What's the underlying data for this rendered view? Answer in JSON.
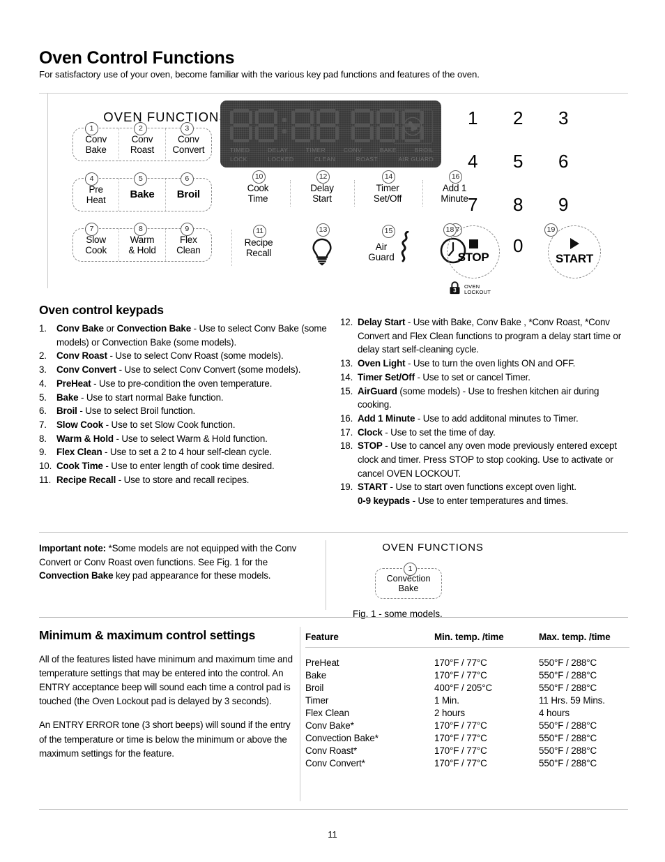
{
  "page": {
    "title": "Oven Control Functions",
    "intro": "For satisfactory use of your oven, become familiar with the various key pad functions and features of the oven.",
    "number": "11"
  },
  "panel": {
    "oven_functions_title": "OVEN FUNCTIONS",
    "groups": [
      {
        "pads": [
          {
            "num": "1",
            "line1": "Conv",
            "line2": "Bake",
            "bold": false
          },
          {
            "num": "2",
            "line1": "Conv",
            "line2": "Roast",
            "bold": false
          },
          {
            "num": "3",
            "line1": "Conv",
            "line2": "Convert",
            "bold": false
          }
        ]
      },
      {
        "pads": [
          {
            "num": "4",
            "line1": "Pre",
            "line2": "Heat",
            "bold": false
          },
          {
            "num": "5",
            "line1": "Bake",
            "line2": "",
            "bold": true
          },
          {
            "num": "6",
            "line1": "Broil",
            "line2": "",
            "bold": true
          }
        ]
      },
      {
        "pads": [
          {
            "num": "7",
            "line1": "Slow",
            "line2": "Cook",
            "bold": false
          },
          {
            "num": "8",
            "line1": "Warm",
            "line2": "& Hold",
            "bold": false
          },
          {
            "num": "9",
            "line1": "Flex",
            "line2": "Clean",
            "bold": false
          }
        ]
      }
    ],
    "display": {
      "digits": "88:88 888",
      "indicator_row_1": [
        "TIMED",
        "DELAY",
        "TIMER",
        "CONV",
        "BAKE",
        "BROIL"
      ],
      "indicator_row_2": [
        "LOCK",
        "LOCKED",
        "CLEAN",
        "ROAST",
        "AIR GUARD"
      ],
      "fan_icon": "convection-fan-icon"
    },
    "mid_pads": [
      {
        "num": "10",
        "line1": "Cook",
        "line2": "Time",
        "icon": ""
      },
      {
        "num": "12",
        "line1": "Delay",
        "line2": "Start",
        "icon": ""
      },
      {
        "num": "14",
        "line1": "Timer",
        "line2": "Set/Off",
        "icon": ""
      },
      {
        "num": "16",
        "line1": "Add 1",
        "line2": "Minute",
        "icon": ""
      },
      {
        "num": "11",
        "line1": "Recipe",
        "line2": "Recall",
        "icon": ""
      },
      {
        "num": "13",
        "line1": "",
        "line2": "",
        "icon": "light-bulb-icon"
      },
      {
        "num": "15",
        "line1": "Air",
        "line2": "Guard",
        "icon": "air-wave-icon"
      },
      {
        "num": "17",
        "line1": "",
        "line2": "",
        "icon": "clock-icon"
      }
    ],
    "numpad": {
      "digits": [
        "1",
        "2",
        "3",
        "4",
        "5",
        "6",
        "7",
        "8",
        "9",
        "0"
      ],
      "stop": {
        "num": "18",
        "label": "STOP",
        "icon": "stop-square-icon"
      },
      "start": {
        "num": "19",
        "label": "START",
        "icon": "play-triangle-icon"
      },
      "lockout": {
        "icon": "padlock-icon",
        "badge": "3",
        "line1": "OVEN",
        "line2": "LOCKOUT"
      }
    }
  },
  "keypads_section": {
    "heading": "Oven control keypads",
    "left_items": [
      {
        "n": "1.",
        "bold": "Conv Bake",
        "bold2": "Convection Bake",
        "text": " or ",
        "rest": " - Use to select Conv Bake (some models) or Convection Bake (some models)."
      },
      {
        "n": "2.",
        "bold": "Conv Roast",
        "rest": " - Use to select Conv Roast (some models)."
      },
      {
        "n": "3.",
        "bold": "Conv Convert",
        "rest": " - Use to select Conv Convert (some models)."
      },
      {
        "n": "4.",
        "bold": "PreHeat",
        "rest": " - Use to pre-condition the oven temperature."
      },
      {
        "n": "5.",
        "bold": "Bake",
        "rest": " - Use to start normal Bake function."
      },
      {
        "n": "6.",
        "bold": "Broil",
        "rest": " - Use to select Broil function."
      },
      {
        "n": "7.",
        "bold": "Slow Cook",
        "rest": " - Use to set Slow Cook function."
      },
      {
        "n": "8.",
        "bold": "Warm & Hold",
        "rest": " - Use to select Warm & Hold function."
      },
      {
        "n": "9.",
        "bold": "Flex Clean",
        "rest": " - Use to set a 2 to 4 hour self-clean cycle."
      },
      {
        "n": "10.",
        "bold": "Cook Time",
        "rest": " - Use to enter length of cook time desired."
      },
      {
        "n": "11.",
        "bold": "Recipe Recall",
        "rest": " - Use to store and recall recipes."
      }
    ],
    "right_items": [
      {
        "n": "12.",
        "bold": "Delay Start",
        "rest": " - Use with Bake, Conv Bake , *Conv Roast, *Conv Convert and Flex Clean functions to program a delay start time or delay start self-cleaning cycle."
      },
      {
        "n": "13.",
        "bold": "Oven Light",
        "rest": " - Use to turn the oven lights ON and OFF."
      },
      {
        "n": "14.",
        "bold": "Timer Set/Off",
        "rest": " - Use to set or cancel Timer."
      },
      {
        "n": "15.",
        "bold": "AirGuard",
        "rest": " (some models) - Use to freshen kitchen air during cooking."
      },
      {
        "n": "16.",
        "bold": "Add 1 Minute",
        "rest": " - Use to add additonal minutes to Timer."
      },
      {
        "n": "17.",
        "bold": "Clock",
        "rest": " - Use to set the time of day."
      },
      {
        "n": "18.",
        "bold": "STOP",
        "rest": " - Use to cancel any oven mode previously entered except clock and timer. Press STOP to stop cooking. Use to activate or cancel OVEN LOCKOUT."
      },
      {
        "n": "19.",
        "bold": "START",
        "rest": " - Use to start oven functions except oven light."
      },
      {
        "n": "",
        "bold": "0-9 keypads",
        "rest": " - Use to enter temperatures and times."
      }
    ]
  },
  "note": {
    "label": "Important note:",
    "text_1": " *Some models are not equipped with the Conv Convert or Conv Roast oven functions. See Fig. 1 for the ",
    "bold_2": "Convection Bake",
    "text_2": " key pad appearance for these models."
  },
  "fig1": {
    "title": "OVEN FUNCTIONS",
    "pad_num": "1",
    "pad_line1": "Convection",
    "pad_line2": "Bake",
    "caption": "Fig. 1 - some models."
  },
  "minmax": {
    "heading": "Minimum & maximum control settings",
    "para1": "All of the features listed have minimum and maximum time and temperature settings that may be entered into the control.  An ENTRY acceptance beep will sound each time a control pad is touched (the Oven Lockout pad is delayed by 3 seconds).",
    "para2": "An ENTRY ERROR tone (3 short beeps) will sound if the entry of the temperature or time is below the minimum or above the maximum settings for the feature."
  },
  "table": {
    "headers": [
      "Feature",
      "Min. temp. /time",
      "Max. temp. /time"
    ],
    "rows": [
      [
        "PreHeat",
        "170°F / 77°C",
        "550°F / 288°C"
      ],
      [
        "Bake",
        "170°F / 77°C",
        "550°F / 288°C"
      ],
      [
        "Broil",
        "400°F / 205°C",
        "550°F / 288°C"
      ],
      [
        "Timer",
        "1 Min.",
        "11 Hrs. 59 Mins."
      ],
      [
        "Flex Clean",
        "2 hours",
        "4 hours"
      ],
      [
        "Conv Bake*",
        "170°F / 77°C",
        "550°F / 288°C"
      ],
      [
        "Convection Bake*",
        "170°F / 77°C",
        "550°F / 288°C"
      ],
      [
        "Conv Roast*",
        "170°F / 77°C",
        "550°F / 288°C"
      ],
      [
        "Conv Convert*",
        "170°F / 77°C",
        "550°F / 288°C"
      ]
    ]
  }
}
